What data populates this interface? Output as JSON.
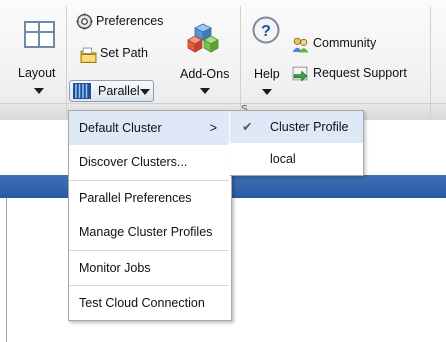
{
  "toolbar": {
    "layout_label": "Layout",
    "preferences_label": "Preferences",
    "set_path_label": "Set Path",
    "parallel_label": "Parallel",
    "addons_label": "Add-Ons",
    "help_label": "Help",
    "community_label": "Community",
    "request_support_label": "Request Support",
    "section_fragment": "S"
  },
  "parallel_menu": {
    "items": [
      {
        "label": "Default Cluster",
        "has_submenu": true
      },
      {
        "label": "Discover Clusters..."
      },
      {
        "label": "Parallel Preferences"
      },
      {
        "label": "Manage Cluster Profiles"
      },
      {
        "label": "Monitor Jobs"
      },
      {
        "label": "Test Cloud Connection"
      }
    ],
    "submenu_arrow": ">"
  },
  "default_cluster_submenu": {
    "items": [
      {
        "label": "Cluster Profile",
        "checked": true
      },
      {
        "label": "local",
        "checked": false
      }
    ],
    "check_glyph": "✔"
  },
  "colors": {
    "accent_bar": "#2f5fa8",
    "menu_highlight": "#dfe8f6"
  },
  "icons": [
    "layout-icon",
    "gear-icon",
    "folder-icon",
    "parallel-icon",
    "addons-icon",
    "help-icon",
    "community-icon",
    "request-support-icon"
  ]
}
